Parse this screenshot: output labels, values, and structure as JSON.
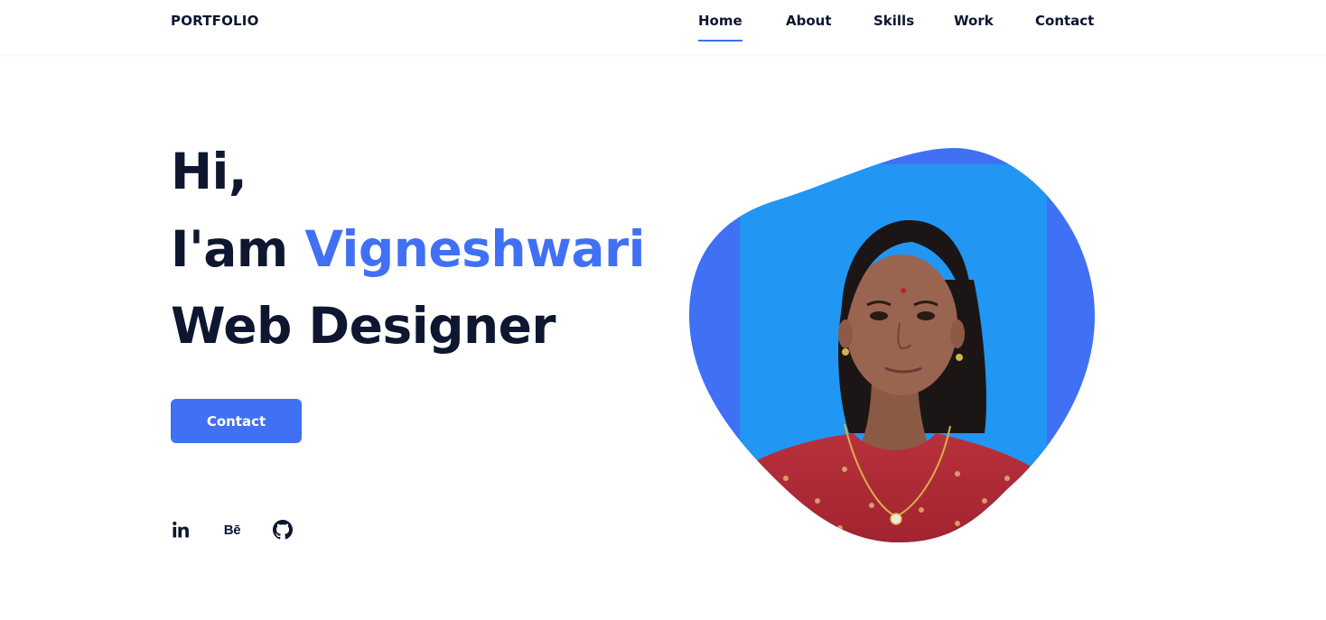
{
  "header": {
    "logo": "PORTFOLIO",
    "nav": [
      {
        "label": "Home",
        "active": true
      },
      {
        "label": "About",
        "active": false
      },
      {
        "label": "Skills",
        "active": false
      },
      {
        "label": "Work",
        "active": false
      },
      {
        "label": "Contact",
        "active": false
      }
    ]
  },
  "hero": {
    "greeting": "Hi,",
    "intro_prefix": "I'am ",
    "name": "Vigneshwari",
    "role": "Web Designer",
    "button_label": "Contact"
  },
  "social": [
    {
      "icon": "linkedin-icon",
      "label": "in"
    },
    {
      "icon": "behance-icon",
      "label": "Bē"
    },
    {
      "icon": "github-icon"
    }
  ],
  "colors": {
    "accent": "#4070f4",
    "text": "#0e1630",
    "photo_background": "#2196f3",
    "blob": "#4070f4",
    "dress": "#b32d3a"
  }
}
